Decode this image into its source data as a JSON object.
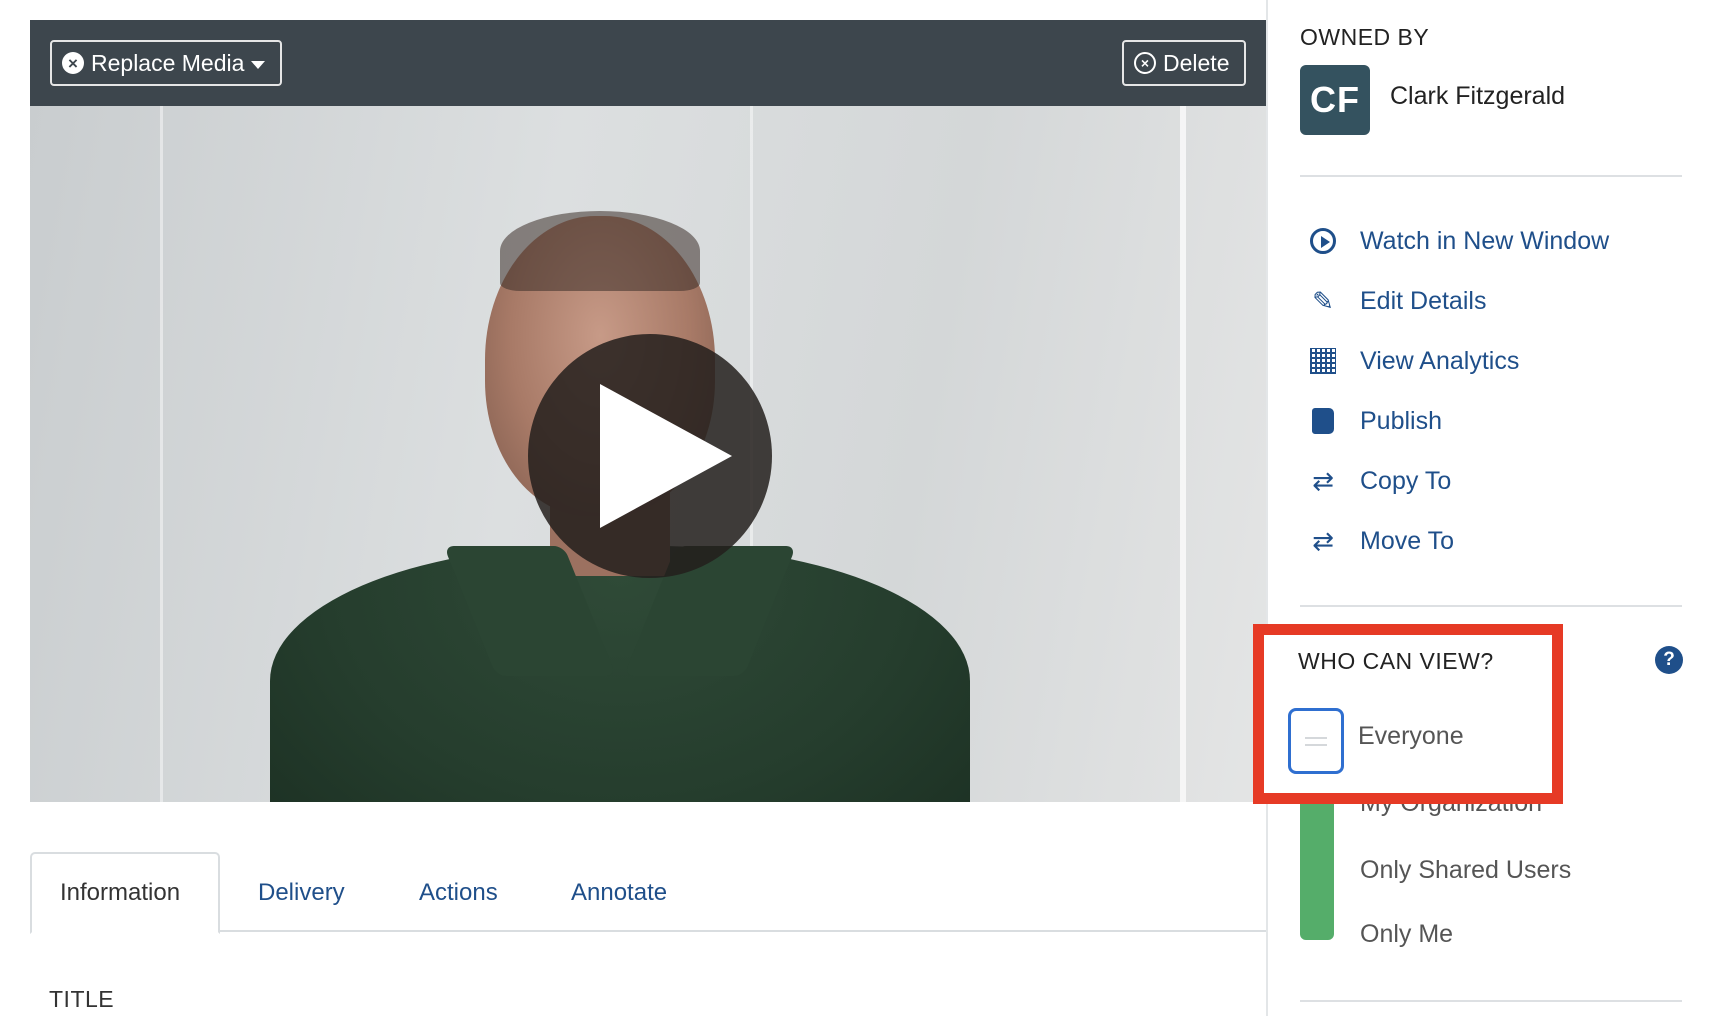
{
  "toolbar": {
    "replace_label": "Replace Media",
    "delete_label": "Delete"
  },
  "tabs": [
    {
      "label": "Information",
      "active": true
    },
    {
      "label": "Delivery",
      "active": false
    },
    {
      "label": "Actions",
      "active": false
    },
    {
      "label": "Annotate",
      "active": false
    }
  ],
  "main": {
    "section_title": "TITLE"
  },
  "sidebar": {
    "owned_by_heading": "OWNED BY",
    "owner": {
      "initials": "CF",
      "name": "Clark Fitzgerald"
    },
    "actions": [
      {
        "label": "Watch in New Window",
        "icon": "play-circle-icon"
      },
      {
        "label": "Edit Details",
        "icon": "edit-icon"
      },
      {
        "label": "View Analytics",
        "icon": "analytics-icon"
      },
      {
        "label": "Publish",
        "icon": "book-icon"
      },
      {
        "label": "Copy To",
        "icon": "swap-arrows-icon"
      },
      {
        "label": "Move To",
        "icon": "swap-arrows-icon"
      }
    ],
    "visibility": {
      "heading": "WHO CAN VIEW?",
      "options": [
        "Everyone",
        "My Organization",
        "Only Shared Users",
        "Only Me"
      ],
      "selected": "Everyone"
    }
  },
  "colors": {
    "toolbar_bg": "#3d464d",
    "link": "#1f4f8a",
    "slider_track": "#55ad6a",
    "slider_thumb_border": "#2f6fd0",
    "highlight": "#e63a25",
    "avatar_bg": "#34525f"
  }
}
